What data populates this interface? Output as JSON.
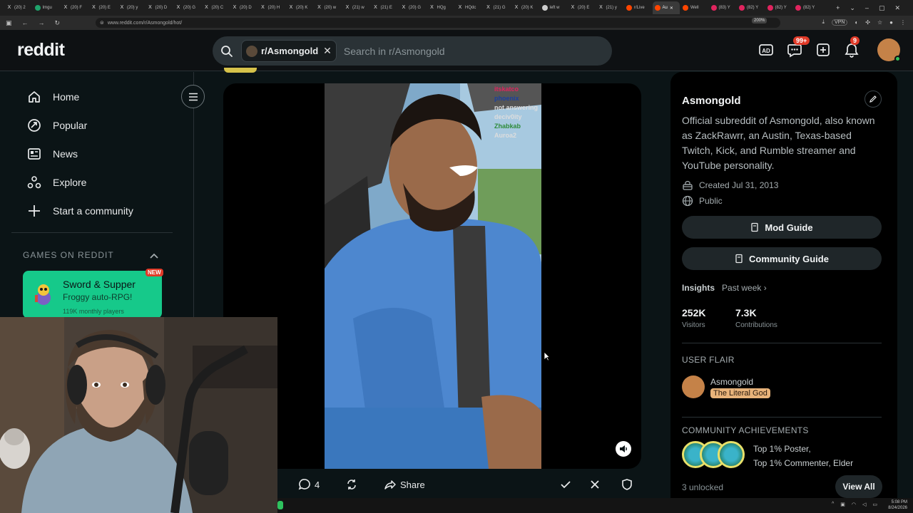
{
  "browser": {
    "tabs": [
      {
        "label": "(20) 2",
        "icon": "x"
      },
      {
        "label": "Imgu",
        "icon": "green"
      },
      {
        "label": "(20) F",
        "icon": "x"
      },
      {
        "label": "(20) E",
        "icon": "x"
      },
      {
        "label": "(20) y",
        "icon": "x"
      },
      {
        "label": "(20) D",
        "icon": "x"
      },
      {
        "label": "(20) G",
        "icon": "x"
      },
      {
        "label": "(20) C",
        "icon": "x"
      },
      {
        "label": "(20) D",
        "icon": "x"
      },
      {
        "label": "(20) H",
        "icon": "x"
      },
      {
        "label": "(20) K",
        "icon": "x"
      },
      {
        "label": "(20) w",
        "icon": "x"
      },
      {
        "label": "(21) w",
        "icon": "x"
      },
      {
        "label": "(21) E",
        "icon": "x"
      },
      {
        "label": "(20) G",
        "icon": "x"
      },
      {
        "label": "HQg",
        "icon": "x"
      },
      {
        "label": "HQdc",
        "icon": "x"
      },
      {
        "label": "(21) G",
        "icon": "x"
      },
      {
        "label": "(20) K",
        "icon": "x"
      },
      {
        "label": "left w",
        "icon": "globe"
      },
      {
        "label": "(20) E",
        "icon": "x"
      },
      {
        "label": "(21) y",
        "icon": "x"
      },
      {
        "label": "r/Live",
        "icon": "reddit"
      },
      {
        "label": "Au",
        "icon": "reddit",
        "active": true
      },
      {
        "label": "Well",
        "icon": "reddit"
      },
      {
        "label": "(83) Y",
        "icon": "red"
      },
      {
        "label": "(82) Y",
        "icon": "red"
      },
      {
        "label": "(82) Y",
        "icon": "red"
      },
      {
        "label": "(82) Y",
        "icon": "red"
      }
    ],
    "url": "www.reddit.com/r/Asmongold/hot/",
    "zoom": "200%",
    "vpn_label": "VPN",
    "clock_time": "5:08 PM",
    "clock_date": "8/24/2026"
  },
  "header": {
    "logo": "reddit",
    "search_chip": "r/Asmongold",
    "search_placeholder": "Search in r/Asmongold",
    "chat_badge": "99+",
    "notif_badge": "9"
  },
  "leftnav": {
    "items": [
      {
        "label": "Home",
        "icon": "home-icon"
      },
      {
        "label": "Popular",
        "icon": "popular-icon"
      },
      {
        "label": "News",
        "icon": "news-icon"
      },
      {
        "label": "Explore",
        "icon": "explore-icon"
      },
      {
        "label": "Start a community",
        "icon": "plus-icon"
      }
    ],
    "games_heading": "GAMES ON REDDIT",
    "game": {
      "title": "Sword & Supper",
      "subtitle": "Froggy auto-RPG!",
      "stat": "119K monthly players",
      "badge": "NEW"
    }
  },
  "post": {
    "comments": "4",
    "share_label": "Share",
    "overlay_names": [
      "itskatco",
      "phoenix",
      "not answering",
      "deciv0ity",
      "Zhabkab",
      "Auroa2"
    ]
  },
  "sidebar": {
    "name": "Asmongold",
    "description": "Official subreddit of Asmongold, also known as ZackRawrr, an Austin, Texas-based Twitch, Kick, and Rumble streamer and YouTube personality.",
    "created": "Created Jul 31, 2013",
    "visibility": "Public",
    "mod_guide": "Mod Guide",
    "community_guide": "Community Guide",
    "insights_label": "Insights",
    "insights_period": "Past week",
    "stats": [
      {
        "value": "252K",
        "label": "Visitors"
      },
      {
        "value": "7.3K",
        "label": "Contributions"
      }
    ],
    "user_flair_heading": "USER FLAIR",
    "flair_user": "Asmongold",
    "flair_tag": "The Literal God",
    "achievements_heading": "COMMUNITY ACHIEVEMENTS",
    "achievement_line1": "Top 1% Poster,",
    "achievement_line2": "Top 1% Commenter, Elder",
    "unlocked": "3 unlocked",
    "view_all": "View All"
  }
}
